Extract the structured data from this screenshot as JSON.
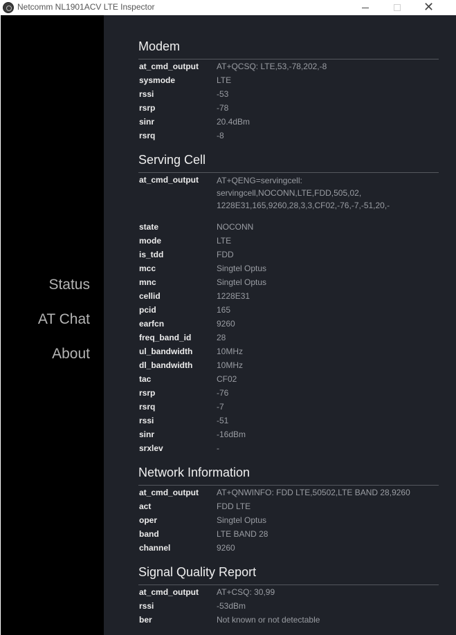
{
  "window": {
    "title": "Netcomm NL1901ACV LTE Inspector",
    "close_glyph": "✕"
  },
  "sidebar": {
    "items": [
      {
        "label": "Status"
      },
      {
        "label": "AT Chat"
      },
      {
        "label": "About"
      }
    ]
  },
  "sections": {
    "modem": {
      "title": "Modem",
      "rows": [
        {
          "key": "at_cmd_output",
          "value": "AT+QCSQ: LTE,53,-78,202,-8"
        },
        {
          "key": "sysmode",
          "value": "LTE"
        },
        {
          "key": "rssi",
          "value": "-53"
        },
        {
          "key": "rsrp",
          "value": "-78"
        },
        {
          "key": "sinr",
          "value": "20.4dBm"
        },
        {
          "key": "rsrq",
          "value": "-8"
        }
      ]
    },
    "serving_cell": {
      "title": "Serving Cell",
      "rows": [
        {
          "key": "at_cmd_output",
          "value": "AT+QENG=servingcell: servingcell,NOCONN,LTE,FDD,505,02, 1228E31,165,9260,28,3,3,CF02,-76,-7,-51,20,-"
        },
        {
          "key": "state",
          "value": "NOCONN"
        },
        {
          "key": "mode",
          "value": "LTE"
        },
        {
          "key": "is_tdd",
          "value": "FDD"
        },
        {
          "key": "mcc",
          "value": "Singtel Optus"
        },
        {
          "key": "mnc",
          "value": "Singtel Optus"
        },
        {
          "key": "cellid",
          "value": "1228E31"
        },
        {
          "key": "pcid",
          "value": "165"
        },
        {
          "key": "earfcn",
          "value": "9260"
        },
        {
          "key": "freq_band_id",
          "value": "28"
        },
        {
          "key": "ul_bandwidth",
          "value": "10MHz"
        },
        {
          "key": "dl_bandwidth",
          "value": "10MHz"
        },
        {
          "key": "tac",
          "value": "CF02"
        },
        {
          "key": "rsrp",
          "value": "-76"
        },
        {
          "key": "rsrq",
          "value": "-7"
        },
        {
          "key": "rssi",
          "value": "-51"
        },
        {
          "key": "sinr",
          "value": "-16dBm"
        },
        {
          "key": "srxlev",
          "value": "-"
        }
      ]
    },
    "network_info": {
      "title": "Network Information",
      "rows": [
        {
          "key": "at_cmd_output",
          "value": "AT+QNWINFO: FDD LTE,50502,LTE BAND 28,9260"
        },
        {
          "key": "act",
          "value": "FDD LTE"
        },
        {
          "key": "oper",
          "value": "Singtel Optus"
        },
        {
          "key": "band",
          "value": "LTE BAND 28"
        },
        {
          "key": "channel",
          "value": "9260"
        }
      ]
    },
    "signal_quality": {
      "title": "Signal Quality Report",
      "rows": [
        {
          "key": "at_cmd_output",
          "value": "AT+CSQ: 30,99"
        },
        {
          "key": "rssi",
          "value": "-53dBm"
        },
        {
          "key": "ber",
          "value": "Not known or not detectable"
        }
      ]
    }
  }
}
